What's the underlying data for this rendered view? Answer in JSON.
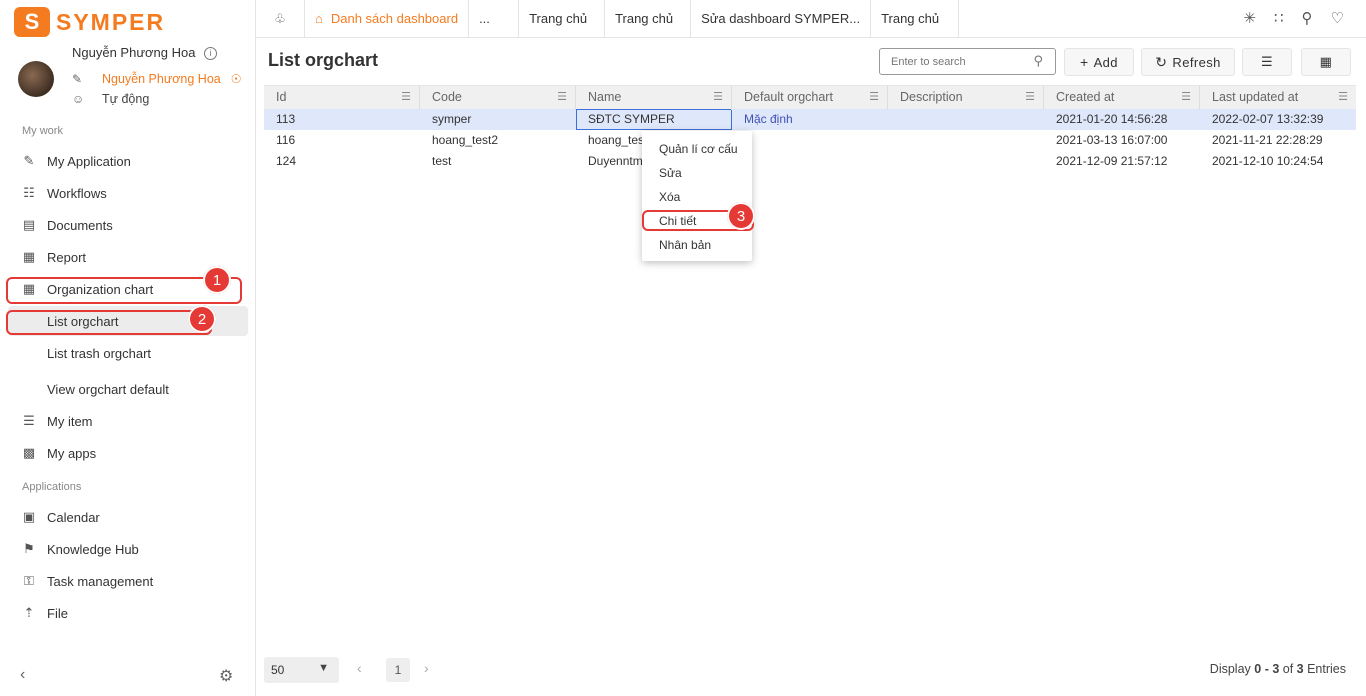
{
  "app": {
    "logo_letter": "S",
    "logo_text": "SYMPER"
  },
  "user": {
    "name": "Nguyễn Phương Hoa",
    "role": "Nguyễn Phương Hoa",
    "mode": "Tự động"
  },
  "sidebar": {
    "section_my_work": "My work",
    "section_applications": "Applications",
    "my_work_items": [
      {
        "label": "My Application",
        "icon": "app-edit-icon"
      },
      {
        "label": "Workflows",
        "icon": "workflow-icon"
      },
      {
        "label": "Documents",
        "icon": "document-icon"
      },
      {
        "label": "Report",
        "icon": "report-icon"
      },
      {
        "label": "Organization chart",
        "icon": "building-icon"
      }
    ],
    "org_sub_items": [
      {
        "label": "List orgchart"
      },
      {
        "label": "List trash orgchart"
      },
      {
        "label": "View orgchart default"
      }
    ],
    "other_items": [
      {
        "label": "My item",
        "icon": "list-icon"
      },
      {
        "label": "My apps",
        "icon": "apps-icon"
      }
    ],
    "app_items": [
      {
        "label": "Calendar",
        "icon": "calendar-icon"
      },
      {
        "label": "Knowledge Hub",
        "icon": "knowledge-icon"
      },
      {
        "label": "Task management",
        "icon": "lock-icon"
      },
      {
        "label": "File",
        "icon": "upload-icon"
      }
    ]
  },
  "annotations": {
    "b1": "1",
    "b2": "2",
    "b3": "3"
  },
  "tabs": [
    {
      "label": "Danh sách dashboard"
    },
    {
      "label": "..."
    },
    {
      "label": "Trang chủ"
    },
    {
      "label": "Trang chủ"
    },
    {
      "label": "Sửa dashboard SYMPER..."
    },
    {
      "label": "Trang chủ"
    }
  ],
  "page": {
    "title": "List orgchart",
    "search_placeholder": "Enter to search",
    "add_label": "Add",
    "refresh_label": "Refresh"
  },
  "table": {
    "columns": [
      "Id",
      "Code",
      "Name",
      "Default orgchart",
      "Description",
      "Created at",
      "Last updated at"
    ],
    "rows": [
      [
        "113",
        "symper",
        "SĐTC SYMPER",
        "Mặc định",
        "",
        "2021-01-20 14:56:28",
        "2022-02-07 13:32:39"
      ],
      [
        "116",
        "hoang_test2",
        "hoang_tes",
        "",
        "",
        "2021-03-13 16:07:00",
        "2021-11-21 22:28:29"
      ],
      [
        "124",
        "test",
        "Duyenntm",
        "",
        "",
        "2021-12-09 21:57:12",
        "2021-12-10 10:24:54"
      ]
    ]
  },
  "context_menu": [
    "Quản lí cơ cấu",
    "Sửa",
    "Xóa",
    "Chi tiết",
    "Nhân bản"
  ],
  "footer": {
    "page_size": "50",
    "current_page": "1",
    "display_prefix": "Display ",
    "display_range": "0 - 3",
    "display_of": " of ",
    "display_total": "3",
    "display_suffix": " Entries"
  },
  "colors": {
    "accent": "#f47b20",
    "highlight": "#e53935",
    "selected_row": "#dfe7fa",
    "link": "#3f51b5"
  }
}
